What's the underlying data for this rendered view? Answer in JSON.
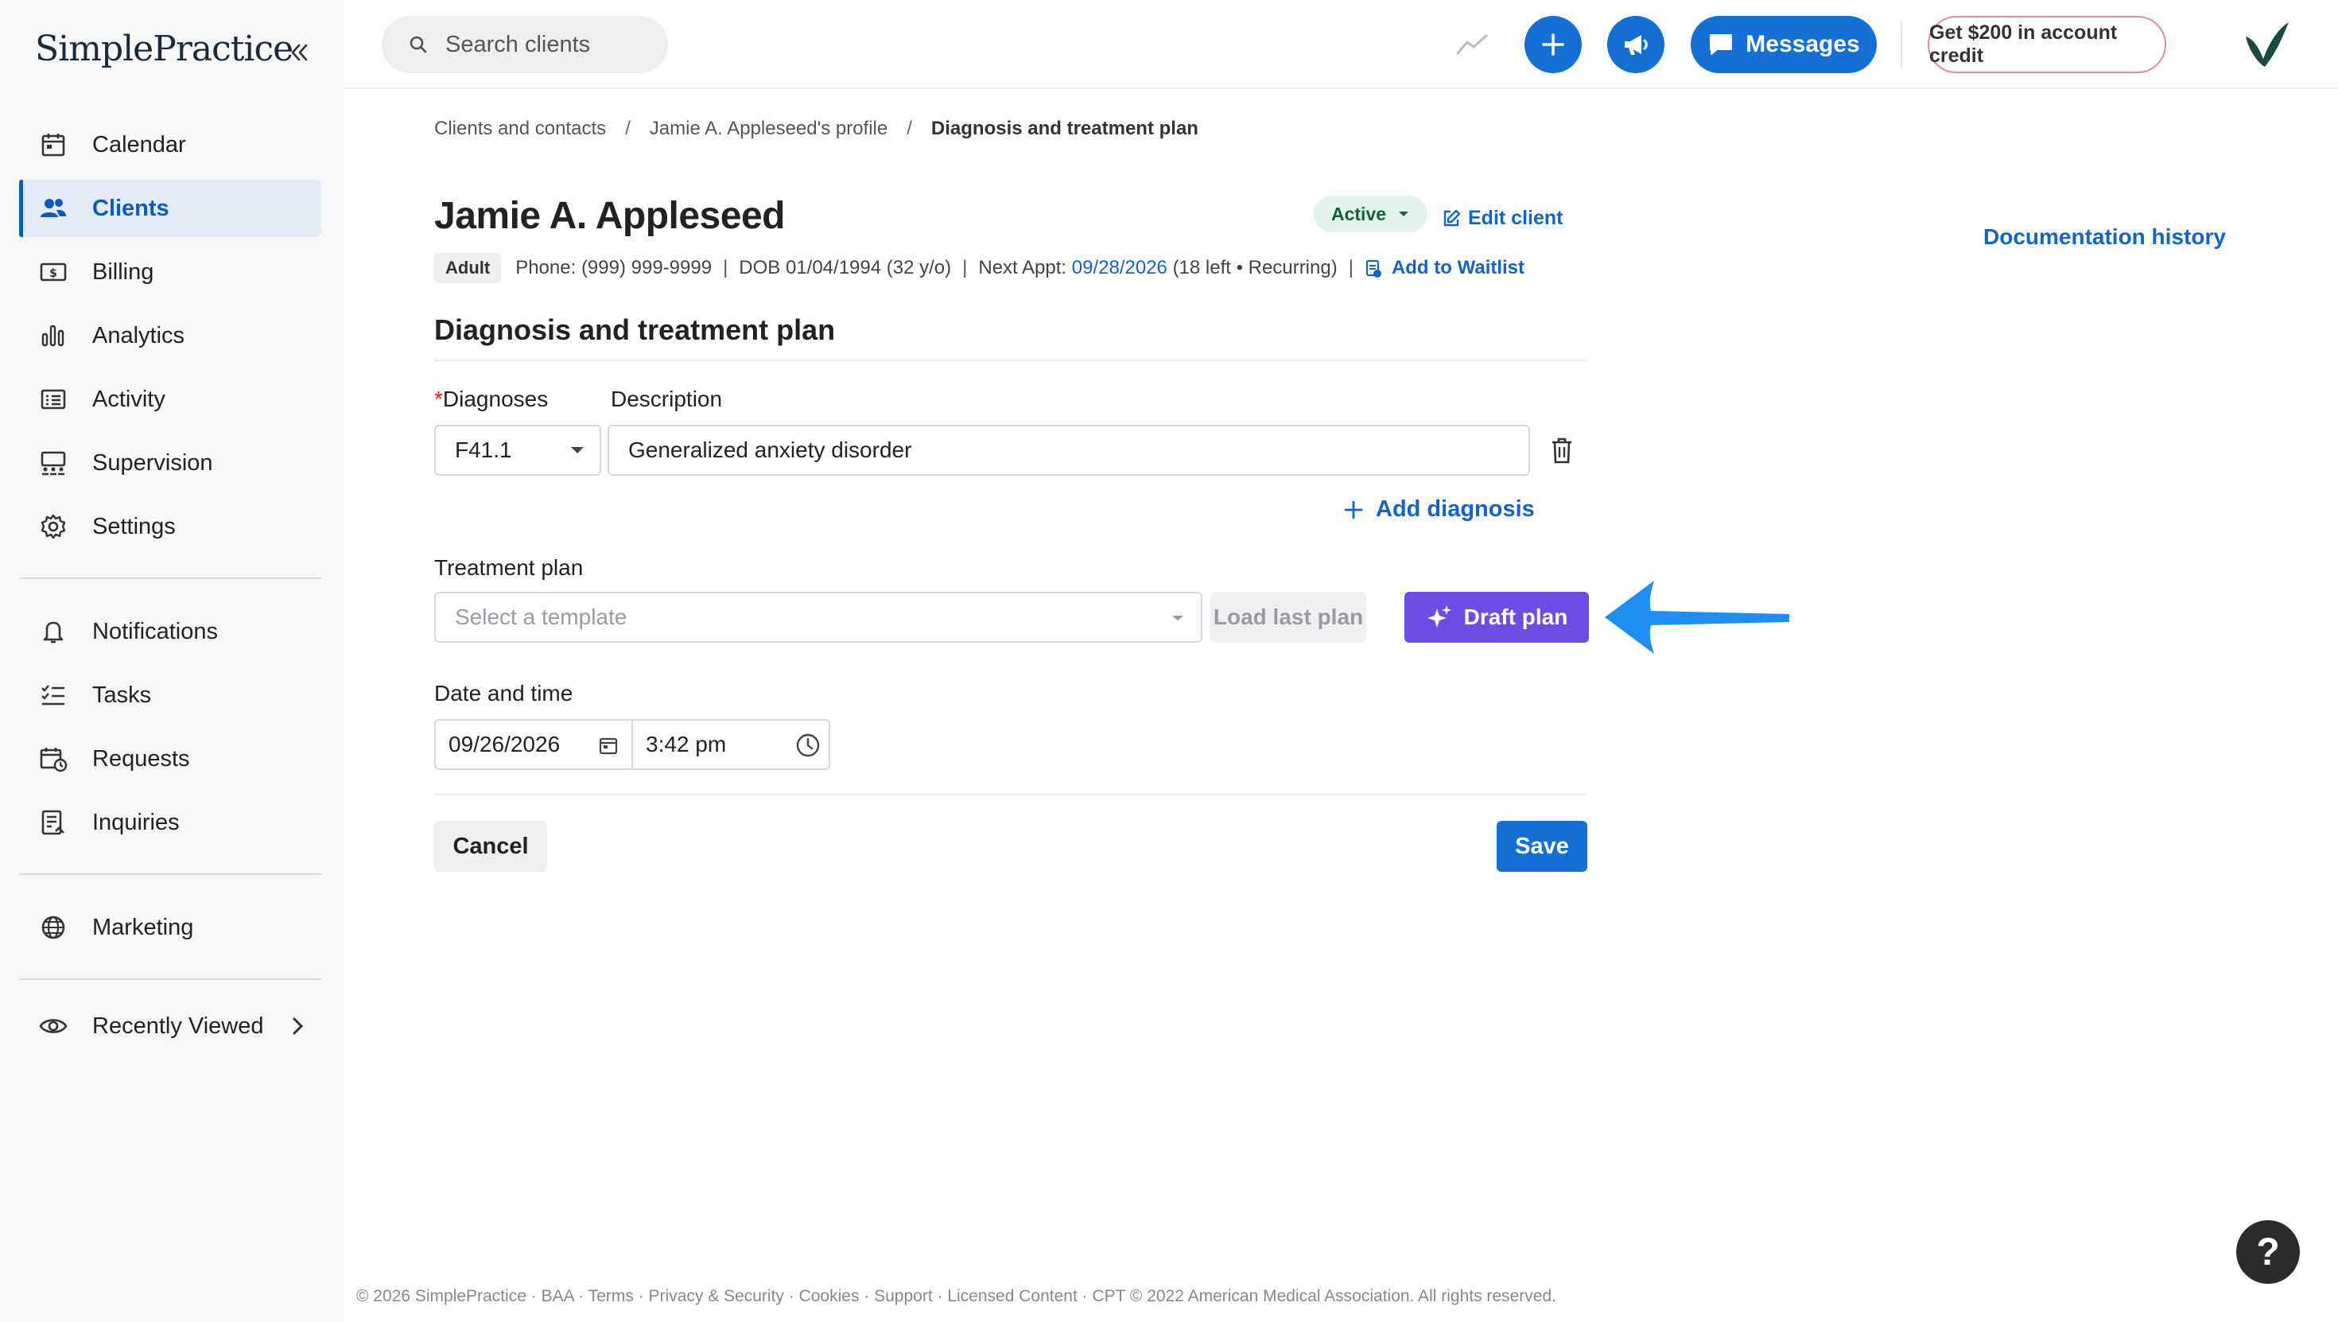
{
  "app": {
    "logo_text": "SimplePractice"
  },
  "sidebar": {
    "items": [
      {
        "label": "Calendar",
        "icon": "calendar-icon"
      },
      {
        "label": "Clients",
        "icon": "users-icon",
        "active": true
      },
      {
        "label": "Billing",
        "icon": "billing-icon"
      },
      {
        "label": "Analytics",
        "icon": "analytics-icon"
      },
      {
        "label": "Activity",
        "icon": "activity-icon"
      },
      {
        "label": "Supervision",
        "icon": "supervision-icon"
      },
      {
        "label": "Settings",
        "icon": "gear-icon"
      },
      {
        "label": "Notifications",
        "icon": "bell-icon"
      },
      {
        "label": "Tasks",
        "icon": "tasks-icon"
      },
      {
        "label": "Requests",
        "icon": "requests-icon"
      },
      {
        "label": "Inquiries",
        "icon": "inquiries-icon"
      },
      {
        "label": "Marketing",
        "icon": "globe-icon"
      },
      {
        "label": "Recently Viewed",
        "icon": "eye-icon"
      }
    ]
  },
  "topbar": {
    "search_placeholder": "Search clients",
    "messages_label": "Messages",
    "credit_label": "Get $200 in account credit"
  },
  "breadcrumb": {
    "items": [
      "Clients and contacts",
      "Jamie A. Appleseed's profile",
      "Diagnosis and treatment plan"
    ]
  },
  "client": {
    "name": "Jamie A. Appleseed",
    "status": "Active",
    "edit_label": "Edit client",
    "type_badge": "Adult",
    "phone": "Phone: (999) 999-9999",
    "dob": "DOB 01/04/1994 (32 y/o)",
    "next_appt_label": "Next Appt:",
    "next_appt_date": "09/28/2026",
    "next_appt_info": "(18 left • Recurring)",
    "waitlist_label": "Add to Waitlist"
  },
  "doc_history_label": "Documentation history",
  "form": {
    "section_title": "Diagnosis and treatment plan",
    "diagnoses_required_mark": "*",
    "diagnoses_label": "Diagnoses",
    "description_label": "Description",
    "diagnosis_code": "F41.1",
    "diagnosis_description": "Generalized anxiety disorder",
    "add_diagnosis_label": "Add diagnosis",
    "treatment_plan_label": "Treatment plan",
    "template_placeholder": "Select a template",
    "load_last_label": "Load last plan",
    "draft_label": "Draft plan",
    "date_time_label": "Date and time",
    "date_value": "09/26/2026",
    "time_value": "3:42 pm",
    "cancel_label": "Cancel",
    "save_label": "Save"
  },
  "footer": {
    "text": "© 2026 SimplePractice · BAA · Terms · Privacy & Security · Cookies · Support · Licensed Content · CPT © 2022 American Medical Association. All rights reserved."
  },
  "help_label": "?",
  "colors": {
    "primary": "#1470d4",
    "draft": "#6c4ee4",
    "active_badge_bg": "#e2f4ec",
    "annotation_arrow": "#1e8ff0"
  }
}
